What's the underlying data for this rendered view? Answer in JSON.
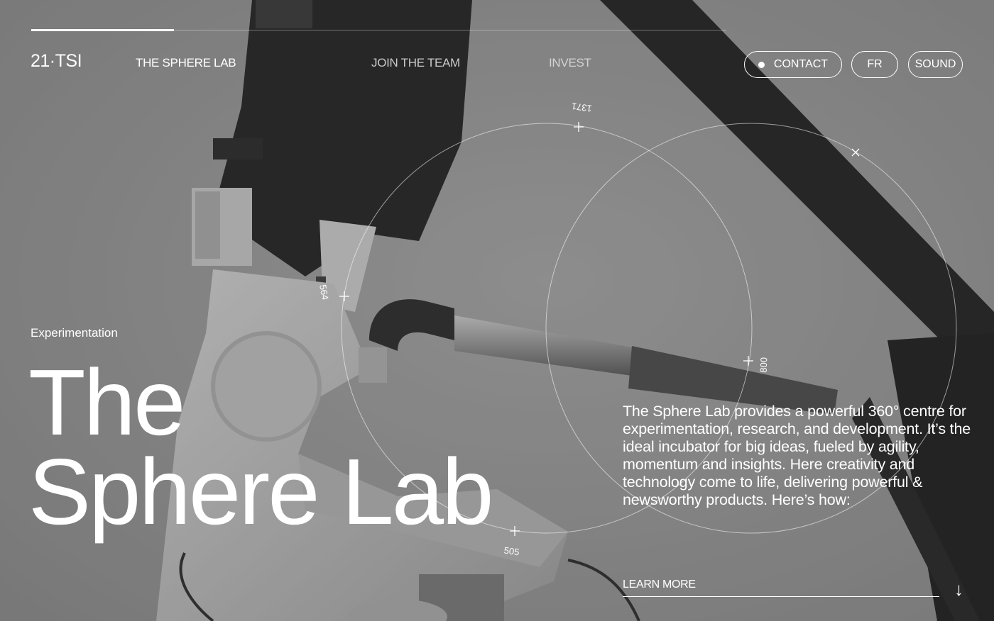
{
  "header": {
    "logo": "21·TSI",
    "nav": [
      {
        "label": "THE SPHERE LAB"
      },
      {
        "label": "JOIN THE TEAM"
      },
      {
        "label": "INVEST"
      }
    ],
    "buttons": {
      "contact": "CONTACT",
      "language": "FR",
      "sound": "SOUND"
    },
    "progress_fraction": 0.205
  },
  "hero": {
    "eyebrow": "Experimentation",
    "title_line1": "The",
    "title_line2": "Sphere Lab",
    "description": "The Sphere Lab provides a powerful 360° centre for experimentation, research, and development. It’s the ideal incubator for big ideas, fueled by agility, momentum and insights. Here creativity and technology come to life, delivering powerful & newsworthy products. Here’s how:",
    "cta": "LEARN MORE",
    "scroll_icon": "arrow-down-icon"
  },
  "coordinates": {
    "top": "1371",
    "left": "564",
    "right": "800",
    "bottom": "505"
  },
  "colors": {
    "text": "#ffffff",
    "background": "#8a8a8a",
    "robot_dark": "#111111"
  }
}
